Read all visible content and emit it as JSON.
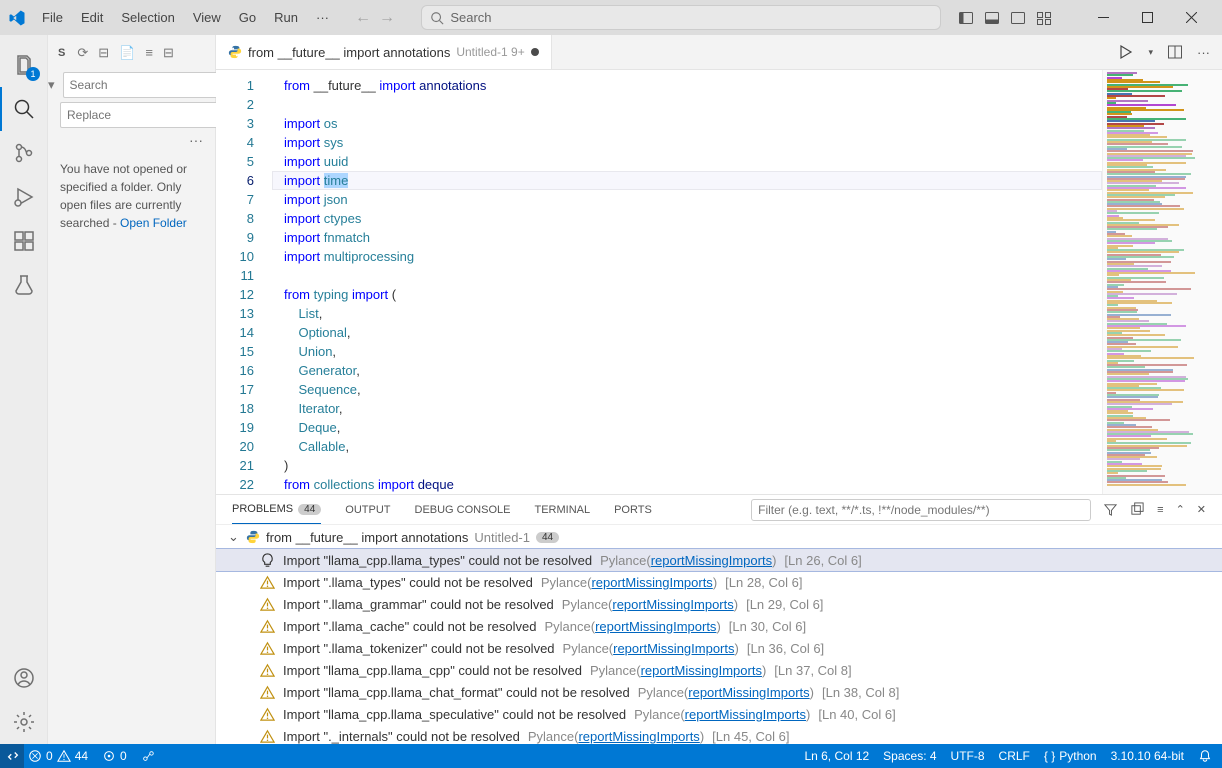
{
  "menu": [
    "File",
    "Edit",
    "Selection",
    "View",
    "Go",
    "Run",
    "···"
  ],
  "search_placeholder": "Search",
  "activity": {
    "explorer_badge": "1"
  },
  "sidebar": {
    "search_placeholder": "Search",
    "replace_placeholder": "Replace",
    "message": "You have not opened or specified a folder. Only open files are currently searched - ",
    "open_folder": "Open Folder"
  },
  "tab": {
    "label": "from __future__ import annotations",
    "desc": "Untitled-1 9+"
  },
  "code_lines": [
    {
      "n": 1,
      "html": "<span class='kw'>from</span> __future__ <span class='kw'>import</span> <span class='mod2'>annotations</span>"
    },
    {
      "n": 2,
      "html": ""
    },
    {
      "n": 3,
      "html": "<span class='kw'>import</span> <span class='mod'>os</span>"
    },
    {
      "n": 4,
      "html": "<span class='kw'>import</span> <span class='mod'>sys</span>"
    },
    {
      "n": 5,
      "html": "<span class='kw'>import</span> <span class='mod'>uuid</span>"
    },
    {
      "n": 6,
      "html": "<span class='kw'>import</span> <span class='sel'><span class='mod'>time</span></span>",
      "current": true
    },
    {
      "n": 7,
      "html": "<span class='kw'>import</span> <span class='mod'>json</span>"
    },
    {
      "n": 8,
      "html": "<span class='kw'>import</span> <span class='mod'>ctypes</span>"
    },
    {
      "n": 9,
      "html": "<span class='kw'>import</span> <span class='mod'>fnmatch</span>"
    },
    {
      "n": 10,
      "html": "<span class='kw'>import</span> <span class='mod'>multiprocessing</span>"
    },
    {
      "n": 11,
      "html": ""
    },
    {
      "n": 12,
      "html": "<span class='kw'>from</span> <span class='mod'>typing</span> <span class='kw'>import</span> ("
    },
    {
      "n": 13,
      "html": "    <span class='mod'>List</span>,"
    },
    {
      "n": 14,
      "html": "    <span class='mod'>Optional</span>,"
    },
    {
      "n": 15,
      "html": "    <span class='mod'>Union</span>,"
    },
    {
      "n": 16,
      "html": "    <span class='mod'>Generator</span>,"
    },
    {
      "n": 17,
      "html": "    <span class='mod'>Sequence</span>,"
    },
    {
      "n": 18,
      "html": "    <span class='mod'>Iterator</span>,"
    },
    {
      "n": 19,
      "html": "    <span class='mod'>Deque</span>,"
    },
    {
      "n": 20,
      "html": "    <span class='mod'>Callable</span>,"
    },
    {
      "n": 21,
      "html": ")"
    },
    {
      "n": 22,
      "html": "<span class='kw'>from</span> <span class='mod'>collections</span> <span class='kw'>import</span> <span class='mod2'>deque</span>"
    }
  ],
  "panel": {
    "tabs": {
      "problems": "PROBLEMS",
      "output": "OUTPUT",
      "debug": "DEBUG CONSOLE",
      "terminal": "TERMINAL",
      "ports": "PORTS"
    },
    "problems_count": "44",
    "filter_placeholder": "Filter (e.g. text, **/*.ts, !**/node_modules/**)",
    "file": {
      "name": "from __future__ import annotations",
      "desc": "Untitled-1",
      "count": "44"
    },
    "problems": [
      {
        "sel": true,
        "icon": "bulb",
        "msg": "Import \"llama_cpp.llama_types\" could not be resolved",
        "src": "Pylance",
        "link": "reportMissingImports",
        "loc": "[Ln 26, Col 6]"
      },
      {
        "icon": "warn",
        "msg": "Import \".llama_types\" could not be resolved",
        "src": "Pylance",
        "link": "reportMissingImports",
        "loc": "[Ln 28, Col 6]"
      },
      {
        "icon": "warn",
        "msg": "Import \".llama_grammar\" could not be resolved",
        "src": "Pylance",
        "link": "reportMissingImports",
        "loc": "[Ln 29, Col 6]"
      },
      {
        "icon": "warn",
        "msg": "Import \".llama_cache\" could not be resolved",
        "src": "Pylance",
        "link": "reportMissingImports",
        "loc": "[Ln 30, Col 6]"
      },
      {
        "icon": "warn",
        "msg": "Import \".llama_tokenizer\" could not be resolved",
        "src": "Pylance",
        "link": "reportMissingImports",
        "loc": "[Ln 36, Col 6]"
      },
      {
        "icon": "warn",
        "msg": "Import \"llama_cpp.llama_cpp\" could not be resolved",
        "src": "Pylance",
        "link": "reportMissingImports",
        "loc": "[Ln 37, Col 8]"
      },
      {
        "icon": "warn",
        "msg": "Import \"llama_cpp.llama_chat_format\" could not be resolved",
        "src": "Pylance",
        "link": "reportMissingImports",
        "loc": "[Ln 38, Col 8]"
      },
      {
        "icon": "warn",
        "msg": "Import \"llama_cpp.llama_speculative\" could not be resolved",
        "src": "Pylance",
        "link": "reportMissingImports",
        "loc": "[Ln 40, Col 6]"
      },
      {
        "icon": "warn",
        "msg": "Import \"._internals\" could not be resolved",
        "src": "Pylance",
        "link": "reportMissingImports",
        "loc": "[Ln 45, Col 6]"
      }
    ]
  },
  "status": {
    "errors": "0",
    "warnings": "44",
    "ports": "0",
    "ln_col": "Ln 6, Col 12",
    "spaces": "Spaces: 4",
    "encoding": "UTF-8",
    "eol": "CRLF",
    "lang": "Python",
    "python": "3.10.10 64-bit"
  }
}
